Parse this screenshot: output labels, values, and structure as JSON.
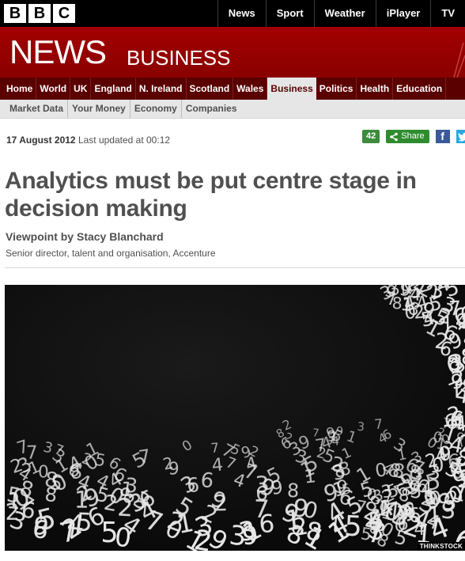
{
  "top_bar": {
    "logo_letters": [
      "B",
      "B",
      "C"
    ],
    "nav": [
      "News",
      "Sport",
      "Weather",
      "iPlayer",
      "TV"
    ]
  },
  "banner": {
    "title": "NEWS",
    "section": "BUSINESS"
  },
  "main_nav": {
    "items": [
      "Home",
      "World",
      "UK",
      "England",
      "N. Ireland",
      "Scotland",
      "Wales",
      "Business",
      "Politics",
      "Health",
      "Education"
    ],
    "active": "Business"
  },
  "sub_nav": {
    "items": [
      "Market Data",
      "Your Money",
      "Economy",
      "Companies"
    ]
  },
  "article_meta": {
    "date": "17 August 2012",
    "updated": "Last updated at 00:12",
    "share_count": "42",
    "share_label": "Share",
    "facebook_glyph": "f"
  },
  "article": {
    "headline": "Analytics must be put centre stage in decision making",
    "byline": "Viewpoint by Stacy Blanchard",
    "role": "Senior director, talent and organisation, Accenture",
    "image_credit": "THINKSTOCK"
  },
  "colors": {
    "brand_red": "#990000",
    "nav_dark_red": "#5a0000",
    "share_green": "#2e8c2e",
    "facebook_blue": "#3b5998",
    "twitter_blue": "#2aa9e0"
  },
  "icons": [
    "share-icon",
    "facebook-icon",
    "twitter-icon"
  ]
}
